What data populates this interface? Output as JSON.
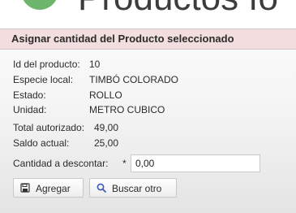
{
  "header": {
    "title": "Productos fo"
  },
  "panel": {
    "title": "Asignar cantidad del Producto seleccionado"
  },
  "details": {
    "id_label": "Id del producto:",
    "id_value": "10",
    "especie_label": "Especie local:",
    "especie_value": "TIMBÓ COLORADO",
    "estado_label": "Estado:",
    "estado_value": "ROLLO",
    "unidad_label": "Unidad:",
    "unidad_value": "METRO CUBICO",
    "total_label": "Total autorizado:",
    "total_value": "49,00",
    "saldo_label": "Saldo actual:",
    "saldo_value": "25,00"
  },
  "form": {
    "cantidad_label": "Cantidad a descontar:",
    "required_mark": "*",
    "cantidad_value": "0,00"
  },
  "buttons": {
    "agregar_label": "Agregar",
    "agregar_icon": "save-icon",
    "buscar_label": "Buscar otro",
    "buscar_icon": "search-icon"
  },
  "colors": {
    "panel_header_bg": "#f2dede",
    "logo": "#6db56d",
    "search_icon": "#3b5bb5"
  }
}
